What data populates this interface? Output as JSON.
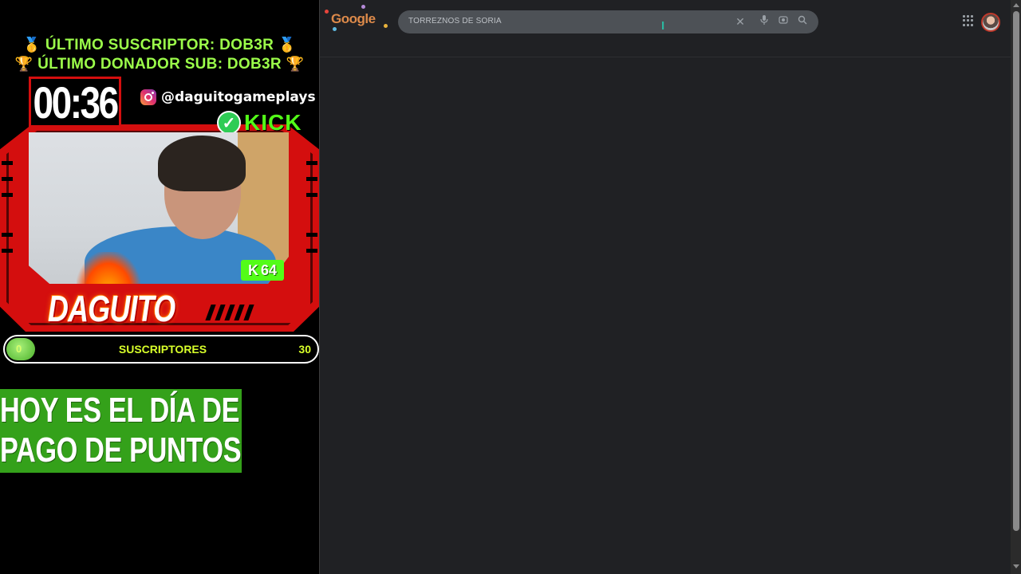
{
  "overlay": {
    "ticker_1": "ÚLTIMO SUSCRIPTOR: DOB3R",
    "ticker_2": "ÚLTIMO DONADOR SUB: DOB3R",
    "timer": "00:36",
    "instagram_handle": "@daguitogameplays",
    "kick_label": "KICK",
    "kick_badge": "64",
    "streamer_name": "DAGUITO",
    "progress": {
      "label": "SUSCRIPTORES",
      "min": "0",
      "max": "30",
      "fraction": 0.0
    },
    "banner": {
      "line_1": "HOY ES EL DÍA DE",
      "line_2": "PAGO DE PUNTOS"
    },
    "colors": {
      "accent_red": "#d40e0e",
      "kick_green": "#53fc18",
      "banner_green": "#34a11a"
    }
  },
  "browser": {
    "logo_text": "Google",
    "search_query": "TORREZNOS DE SORIA",
    "icons": [
      "close-icon",
      "mic-icon",
      "lens-icon",
      "search-icon",
      "apps-grid-icon",
      "avatar"
    ]
  }
}
